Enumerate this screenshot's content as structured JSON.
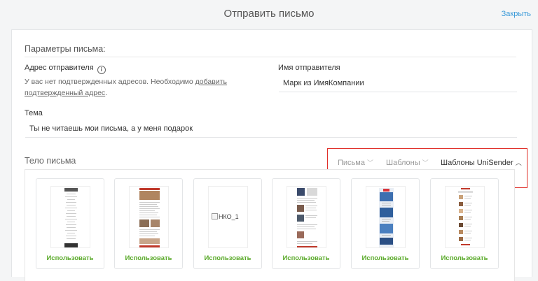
{
  "header": {
    "title": "Отправить письмо",
    "close_label": "Закрыть"
  },
  "params": {
    "section_title": "Параметры письма:",
    "sender_address_label": "Адрес отправителя",
    "sender_address_note": "У вас нет подтвержденных адресов. Необходимо ",
    "sender_address_link": "добавить подтвержденный адрес",
    "sender_address_note_end": ".",
    "sender_name_label": "Имя отправителя",
    "sender_name_value": "Марк из ИмяКомпании",
    "subject_label": "Тема",
    "subject_value": "Ты не читаешь мои письма, а у меня подарок"
  },
  "body": {
    "label": "Тело письма",
    "tabs": [
      {
        "label": "Письма",
        "active": false
      },
      {
        "label": "Шаблоны",
        "active": false
      },
      {
        "label": "Шаблоны UniSender",
        "active": true
      }
    ],
    "templates": [
      {
        "use_label": "Использовать",
        "style": "plain"
      },
      {
        "use_label": "Использовать",
        "style": "photos"
      },
      {
        "use_label": "Использовать",
        "style": "broken",
        "alt": "НКО_1"
      },
      {
        "use_label": "Использовать",
        "style": "portraits"
      },
      {
        "use_label": "Использовать",
        "style": "blue"
      },
      {
        "use_label": "Использовать",
        "style": "products"
      }
    ]
  },
  "colors": {
    "accent_link": "#3a9ad9",
    "use_green": "#5aaa2a",
    "highlight_red": "#e0302a"
  }
}
